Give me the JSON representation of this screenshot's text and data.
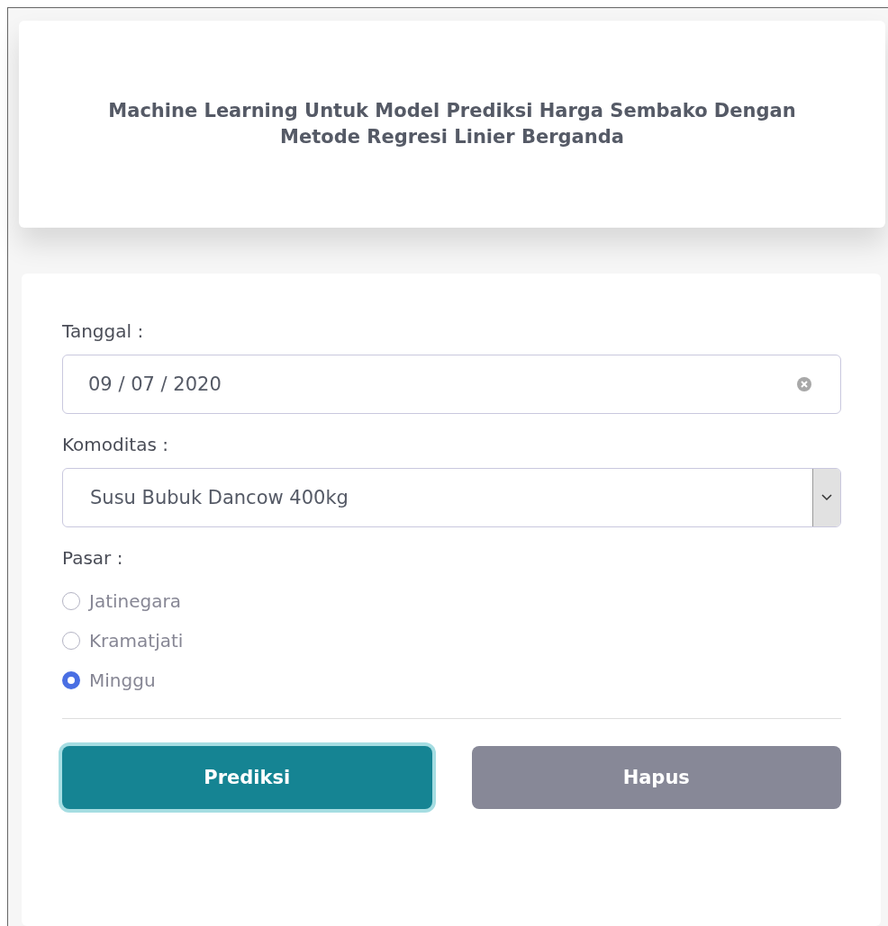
{
  "header": {
    "title": "Machine Learning Untuk Model Prediksi Harga Sembako Dengan Metode Regresi Linier Berganda"
  },
  "form": {
    "date_field": {
      "label": "Tanggal :",
      "value": "09 / 07 / 2020"
    },
    "commodity_select": {
      "label": "Komoditas :",
      "value": "Susu Bubuk Dancow 400kg"
    },
    "market": {
      "label": "Pasar :",
      "options": [
        {
          "label": "Jatinegara",
          "selected": false
        },
        {
          "label": "Kramatjati",
          "selected": false
        },
        {
          "label": "Minggu",
          "selected": true
        }
      ]
    },
    "buttons": [
      {
        "label": "Prediksi",
        "kind": "primary",
        "focused": true
      },
      {
        "label": "Hapus",
        "kind": "secondary",
        "focused": false
      }
    ]
  }
}
